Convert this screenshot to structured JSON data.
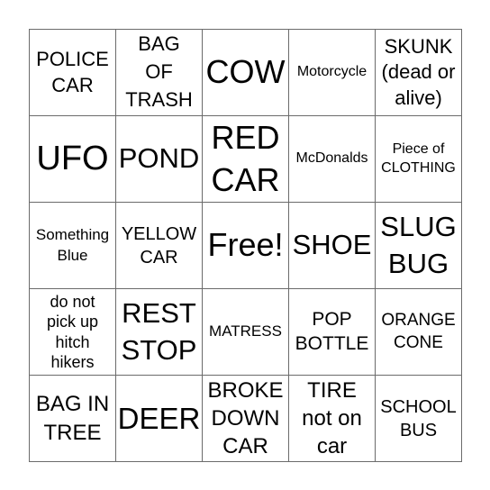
{
  "card": {
    "rows": [
      [
        "POLICE\nCAR",
        "BAG\nOF\nTRASH",
        "COW",
        "Motorcycle",
        "SKUNK\n(dead or\nalive)"
      ],
      [
        "UFO",
        "POND",
        "RED\nCAR",
        "McDonalds",
        "Piece of\nCLOTHING"
      ],
      [
        "Something\nBlue",
        "YELLOW\nCAR",
        "Free!",
        "SHOE",
        "SLUG\nBUG"
      ],
      [
        "do not\npick up\nhitch\nhikers",
        "REST\nSTOP",
        "MATRESS",
        "POP\nBOTTLE",
        "ORANGE\nCONE"
      ],
      [
        "BAG IN\nTREE",
        "DEER",
        "BROKE\nDOWN\nCAR",
        "TIRE\nnot on\ncar",
        "SCHOOL\nBUS"
      ]
    ],
    "free_space": "Free!"
  }
}
